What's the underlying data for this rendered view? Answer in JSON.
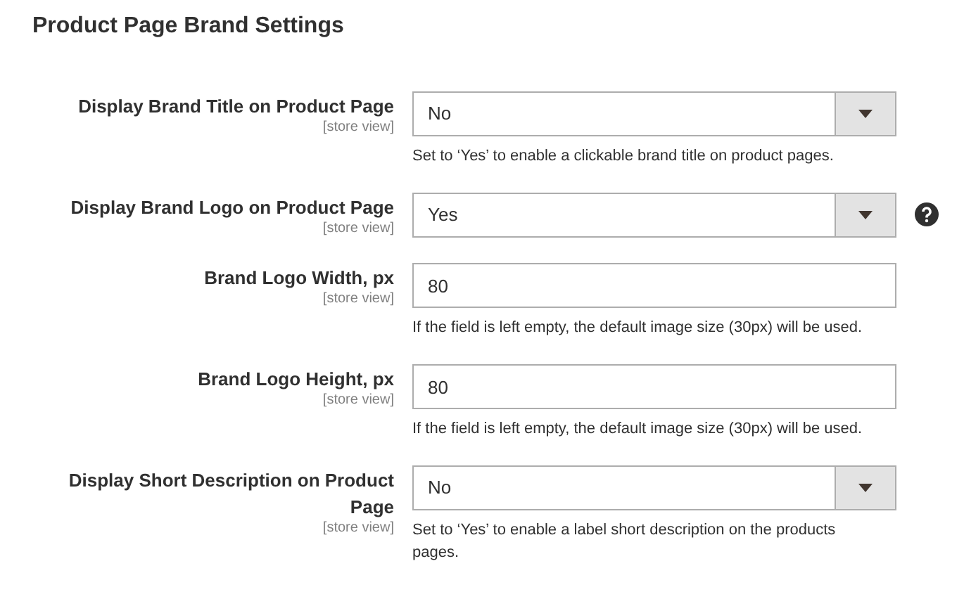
{
  "section": {
    "title": "Product Page Brand Settings"
  },
  "fields": [
    {
      "kind": "select",
      "label": "Display Brand Title on Product Page",
      "scope": "[store view]",
      "value": "No",
      "note": "Set to ‘Yes’ to enable a clickable brand title on product pages.",
      "help": false
    },
    {
      "kind": "select",
      "label": "Display Brand Logo on Product Page",
      "scope": "[store view]",
      "value": "Yes",
      "help": true
    },
    {
      "kind": "text",
      "label": "Brand Logo Width, px",
      "scope": "[store view]",
      "value": "80",
      "note": "If the field is left empty, the default image size (30px) will be used.",
      "help": false
    },
    {
      "kind": "text",
      "label": "Brand Logo Height, px",
      "scope": "[store view]",
      "value": "80",
      "note": "If the field is left empty, the default image size (30px) will be used.",
      "help": false
    },
    {
      "kind": "select",
      "label": "Display Short Description on Product Page",
      "scope": "[store view]",
      "value": "No",
      "note": "Set to ‘Yes’ to enable a label short description on the products pages.",
      "help": false
    }
  ]
}
